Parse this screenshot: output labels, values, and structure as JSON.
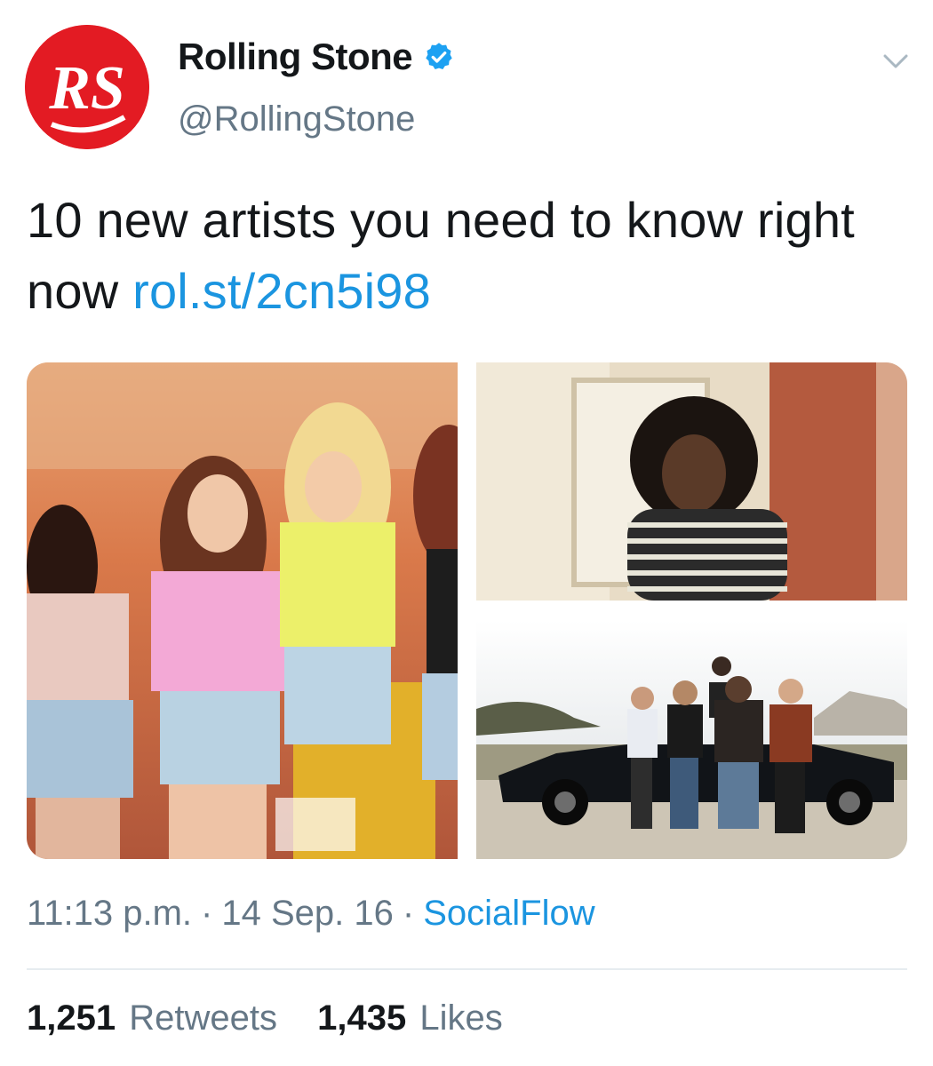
{
  "account": {
    "display_name": "Rolling Stone",
    "handle": "@RollingStone",
    "avatar_initials": "RS",
    "verified": true,
    "avatar_color": "#e31b23"
  },
  "tweet": {
    "text": "10 new artists you need to know right now ",
    "link_text": "rol.st/2cn5i98"
  },
  "meta": {
    "time": "11:13 p.m.",
    "separator": "·",
    "date": "14 Sep. 16",
    "source": "SocialFlow"
  },
  "stats": {
    "retweets_count": "1,251",
    "retweets_label": "Retweets",
    "likes_count": "1,435",
    "likes_label": "Likes"
  },
  "colors": {
    "link": "#1b95e0",
    "secondary_text": "#657786",
    "primary_text": "#14171a",
    "verified_badge": "#1da1f2"
  },
  "icons": {
    "verified": "verified-badge-icon",
    "more": "chevron-down-icon"
  }
}
